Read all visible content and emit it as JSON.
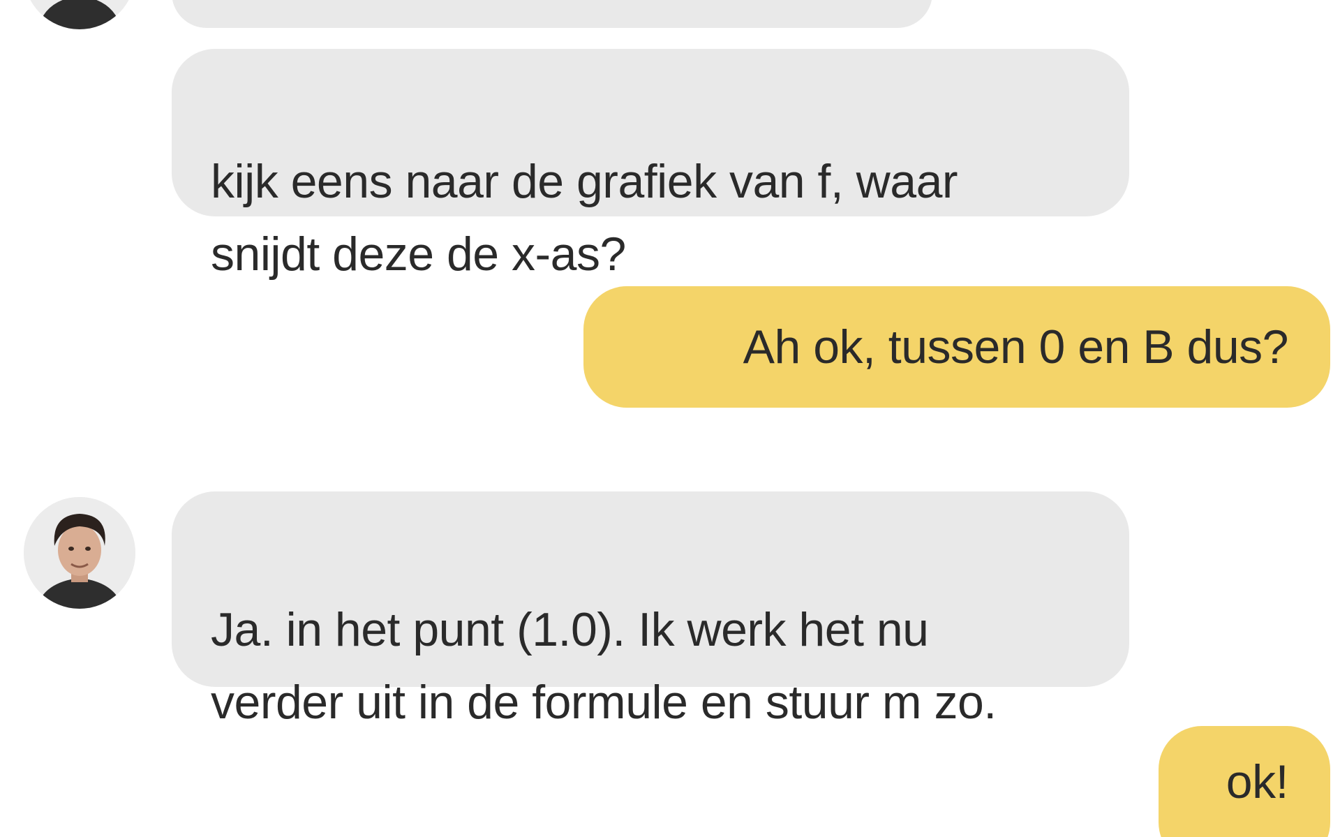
{
  "messages": [
    {
      "sender": "tutor",
      "text": ""
    },
    {
      "sender": "tutor",
      "text": "kijk eens naar de grafiek van f, waar\nsnijdt deze de x-as?"
    },
    {
      "sender": "student",
      "text": "Ah ok, tussen 0 en B dus?"
    },
    {
      "sender": "tutor",
      "text": "Ja. in het punt (1.0). Ik werk het nu\nverder uit in de formule en stuur m zo."
    },
    {
      "sender": "student",
      "text": "ok!"
    }
  ],
  "colors": {
    "incoming_bubble": "#e9e9e9",
    "outgoing_bubble": "#f4d469",
    "text": "#2a2a2a",
    "background": "#ffffff"
  },
  "icons": {
    "avatar": "tutor-avatar-photo"
  }
}
